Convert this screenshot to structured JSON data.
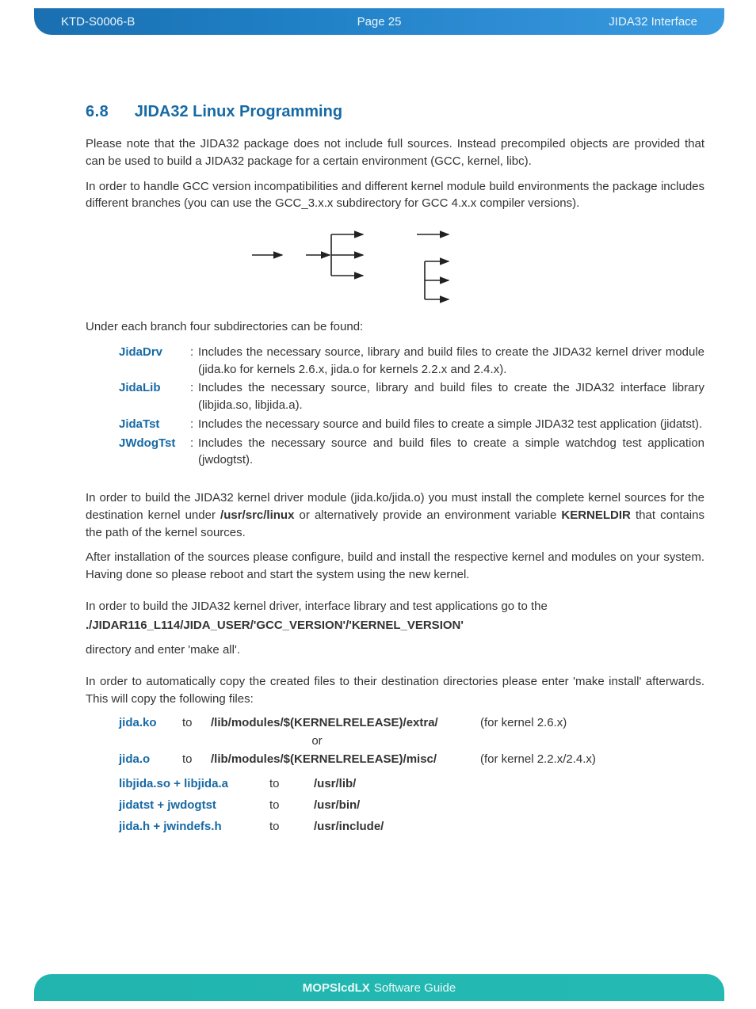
{
  "header": {
    "left": "KTD-S0006-B",
    "center": "Page 25",
    "right": "JIDA32 Interface"
  },
  "section": {
    "number": "6.8",
    "title": "JIDA32 Linux Programming"
  },
  "para1": "Please note that the JIDA32 package does not include full sources. Instead precompiled objects are provided that can be used to build a JIDA32 package for a certain environment (GCC, kernel, libc).",
  "para1b": "In order to handle GCC version incompatibilities and different kernel module build environments the package includes different branches (you can use the GCC_3.x.x subdirectory for GCC 4.x.x compiler versions).",
  "subdir_intro": "Under each branch four subdirectories can be found:",
  "subdirs": [
    {
      "name": "JidaDrv",
      "desc": "Includes the necessary source, library and build files to create the JIDA32 kernel driver module (jida.ko for kernels 2.6.x, jida.o for kernels 2.2.x and 2.4.x)."
    },
    {
      "name": "JidaLib",
      "desc": "Includes the necessary source, library and build files to create the JIDA32 interface library (libjida.so, libjida.a)."
    },
    {
      "name": "JidaTst",
      "desc": "Includes the necessary source and build files to create a simple JIDA32 test application (jidatst)."
    },
    {
      "name": "JWdogTst",
      "desc": "Includes the necessary source and build files to create a simple watchdog test application (jwdogtst)."
    }
  ],
  "para_kernel_a": "In order to build the JIDA32 kernel driver module (jida.ko/jida.o) you must install the complete kernel sources for the destination kernel under ",
  "para_kernel_b": "/usr/src/linux",
  "para_kernel_c": " or alternatively provide an environment variable ",
  "para_kernel_d": "KERNELDIR",
  "para_kernel_e": " that contains the path of the kernel sources.",
  "para_kernel2": "After installation of the sources please configure, build and install the respective kernel and modules on your system. Having done so please reboot and start the system using the new kernel.",
  "build_intro": "In order to build the JIDA32 kernel driver, interface library and test applications go to the",
  "build_path": "./JIDAR116_L114/JIDA_USER/'GCC_VERSION'/'KERNEL_VERSION'",
  "build_after": "directory and enter 'make all'.",
  "install_intro": "In order to automatically copy the created files to their destination directories please enter 'make install' afterwards. This will copy the following files:",
  "to": "to",
  "or": "or",
  "install_rows1": [
    {
      "file": "jida.ko",
      "dest": "/lib/modules/$(KERNELRELEASE)/extra/",
      "note": "(for kernel 2.6.x)"
    },
    {
      "file": "jida.o",
      "dest": "/lib/modules/$(KERNELRELEASE)/misc/",
      "note": "(for kernel 2.2.x/2.4.x)"
    }
  ],
  "install_rows2": [
    {
      "files": "libjida.so + libjida.a",
      "dest": "/usr/lib/"
    },
    {
      "files": "jidatst + jwdogtst",
      "dest": "/usr/bin/"
    },
    {
      "files": "jida.h + jwindefs.h",
      "dest": "/usr/include/"
    }
  ],
  "footer": {
    "strong": "MOPSlcdLX",
    "rest": "Software Guide"
  }
}
